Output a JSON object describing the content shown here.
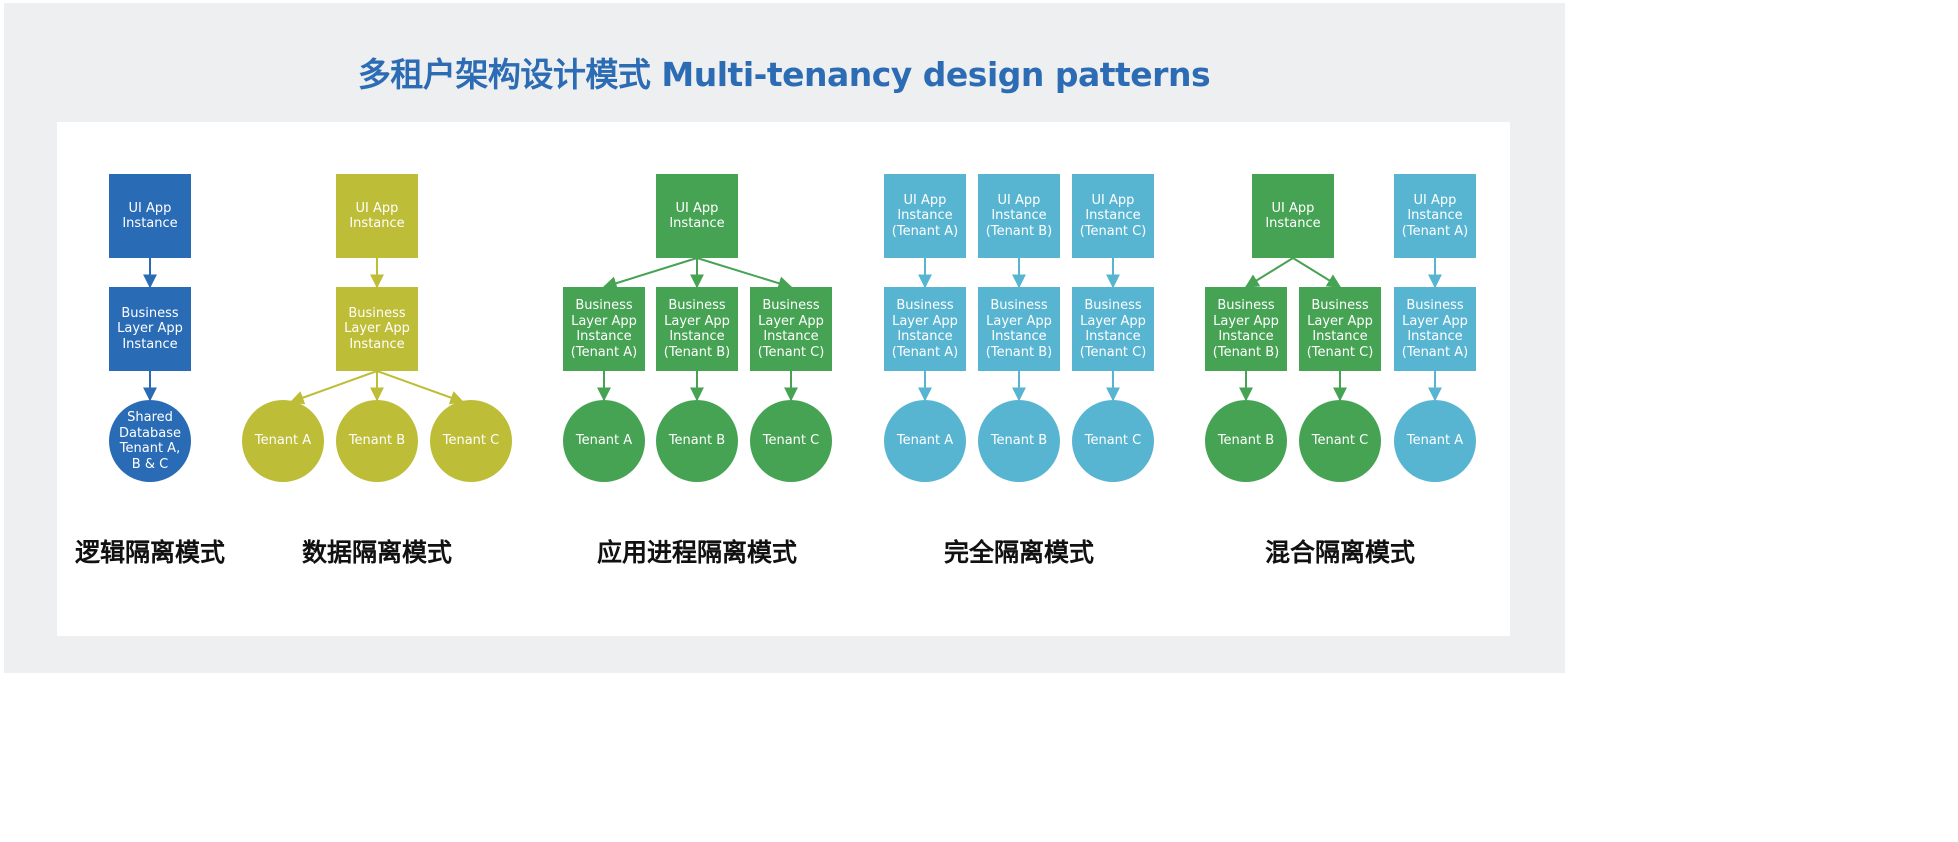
{
  "title": "多租户架构设计模式 Multi-tenancy design patterns",
  "colors": {
    "background": "#eeeff0",
    "title": "#2c6cb4",
    "blue": "#2a6bb5",
    "olive": "#bdbd38",
    "green": "#46a353",
    "cyan": "#58b5d1"
  },
  "sections": [
    {
      "label": "逻辑隔离模式"
    },
    {
      "label": "数据隔离模式"
    },
    {
      "label": "应用进程隔离模式"
    },
    {
      "label": "完全隔离模式"
    },
    {
      "label": "混合隔离模式"
    }
  ],
  "nodes": {
    "logical_ui": "UI App\nInstance",
    "logical_biz": "Business\nLayer App\nInstance",
    "logical_db": "Shared\nDatabase\nTenant A,\nB & C",
    "data_ui": "UI App\nInstance",
    "data_biz": "Business\nLayer App\nInstance",
    "data_tenant_a": "Tenant A",
    "data_tenant_b": "Tenant B",
    "data_tenant_c": "Tenant C",
    "proc_ui": "UI App\nInstance",
    "proc_biz_a": "Business\nLayer App\nInstance\n(Tenant A)",
    "proc_biz_b": "Business\nLayer App\nInstance\n(Tenant B)",
    "proc_biz_c": "Business\nLayer App\nInstance\n(Tenant C)",
    "proc_tenant_a": "Tenant A",
    "proc_tenant_b": "Tenant B",
    "proc_tenant_c": "Tenant C",
    "full_ui_a": "UI App\nInstance\n(Tenant A)",
    "full_ui_b": "UI App\nInstance\n(Tenant B)",
    "full_ui_c": "UI App\nInstance\n(Tenant C)",
    "full_biz_a": "Business\nLayer App\nInstance\n(Tenant A)",
    "full_biz_b": "Business\nLayer App\nInstance\n(Tenant B)",
    "full_biz_c": "Business\nLayer App\nInstance\n(Tenant C)",
    "full_tenant_a": "Tenant A",
    "full_tenant_b": "Tenant B",
    "full_tenant_c": "Tenant C",
    "hybrid_ui": "UI App\nInstance",
    "hybrid_ui_a": "UI App\nInstance\n(Tenant A)",
    "hybrid_biz_b": "Business\nLayer App\nInstance\n(Tenant B)",
    "hybrid_biz_c": "Business\nLayer App\nInstance\n(Tenant C)",
    "hybrid_biz_a": "Business\nLayer App\nInstance\n(Tenant A)",
    "hybrid_tenant_b": "Tenant B",
    "hybrid_tenant_c": "Tenant C",
    "hybrid_tenant_a": "Tenant A"
  }
}
